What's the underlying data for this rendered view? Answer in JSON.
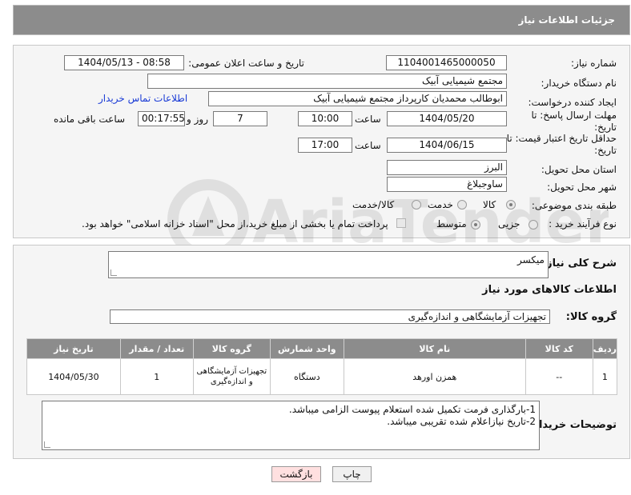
{
  "header": {
    "title": "جزئیات اطلاعات نیاز"
  },
  "form": {
    "need_number_label": "شماره نیاز:",
    "need_number": "1104001465000050",
    "announce_label": "تاریخ و ساعت اعلان عمومی:",
    "announce_value": "1404/05/13 - 08:58",
    "buyer_org_label": "نام دستگاه خریدار:",
    "buyer_org": "مجتمع شیمیایی آبیک",
    "creator_label": "ایجاد کننده درخواست:",
    "creator": "ابوطالب محمدیان کارپرداز مجتمع شیمیایی آبیک",
    "contact_link": "اطلاعات تماس خریدار",
    "deadline_label": "مهلت ارسال پاسخ: تا تاریخ:",
    "deadline_date": "1404/05/20",
    "time_label": "ساعت",
    "deadline_time": "10:00",
    "days_value": "7",
    "days_label": "روز و",
    "remaining_time": "00:17:55",
    "remaining_label": "ساعت باقی مانده",
    "validity_label": "حداقل تاریخ اعتبار قیمت: تا تاریخ:",
    "validity_date": "1404/06/15",
    "validity_time_label": "ساعت",
    "validity_time": "17:00",
    "province_label": "استان محل تحویل:",
    "province": "البرز",
    "city_label": "شهر محل تحویل:",
    "city": "ساوجبلاغ",
    "category_label": "طبقه بندی موضوعی:",
    "category_options": [
      "کالا",
      "خدمت",
      "کالا/خدمت"
    ],
    "category_selected": "کالا",
    "process_label": "نوع فرآیند خرید :",
    "process_options": [
      "جزیی",
      "متوسط"
    ],
    "process_selected": "متوسط",
    "payment_note": "پرداخت تمام یا بخشی از مبلغ خرید،از محل \"اسناد خزانه اسلامی\" خواهد بود."
  },
  "summary": {
    "label": "شرح کلی نیاز:",
    "value": "میکسر",
    "goods_info_title": "اطلاعات کالاهای مورد نیاز",
    "group_label": "گروه کالا:",
    "group_value": "تجهیزات آزمایشگاهی و اندازه‌گیری"
  },
  "table": {
    "headers": [
      "ردیف",
      "کد کالا",
      "نام کالا",
      "واحد شمارش",
      "گروه کالا",
      "تعداد / مقدار",
      "تاریخ نیاز"
    ],
    "rows": [
      [
        "1",
        "--",
        "همزن اورهد",
        "دستگاه",
        "تجهیزات آزمایشگاهی و اندازه‌گیری",
        "1",
        "1404/05/30"
      ]
    ]
  },
  "buyer_notes": {
    "label": "توضیحات خریدار:",
    "line1": "1-بارگذاری فرمت تکمیل شده استعلام پیوست الزامی میباشد.",
    "line2": "2-تاریخ نیازاعلام شده تقریبی میباشد."
  },
  "buttons": {
    "print": "چاپ",
    "back": "بازگشت"
  },
  "colors": {
    "header_bg": "#8c8c8c",
    "link": "#1a3bd6",
    "back_bg": "#ffe0e0"
  },
  "watermark": {
    "text": "AriaTender.neT"
  }
}
